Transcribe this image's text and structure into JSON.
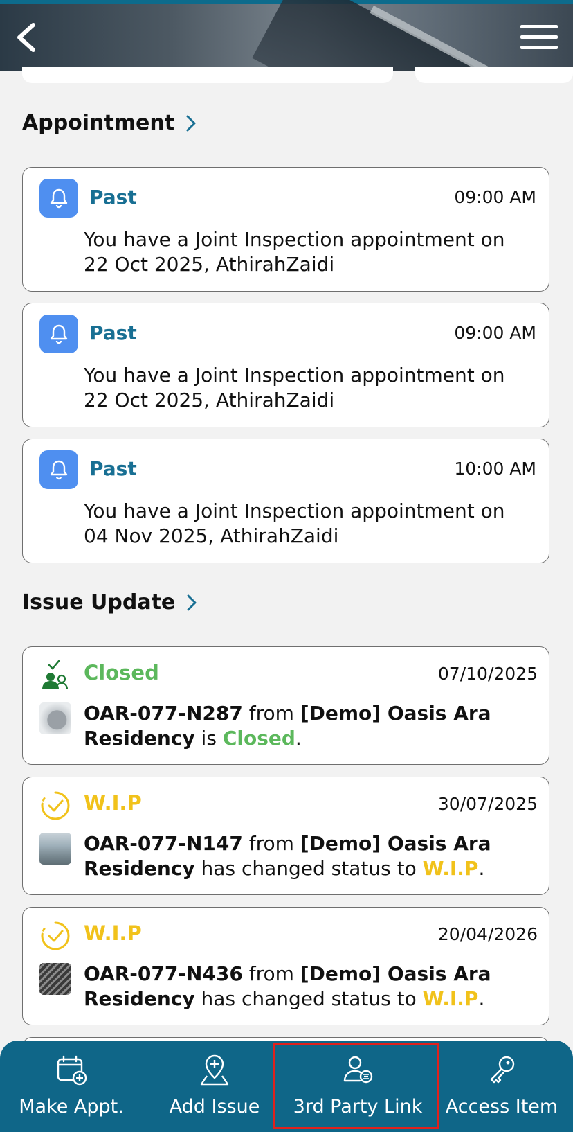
{
  "header": {
    "back_icon": "chevron-left-icon",
    "menu_icon": "hamburger-menu-icon"
  },
  "appointment": {
    "title": "Appointment",
    "items": [
      {
        "status": "Past",
        "time": "09:00 AM",
        "text": "You have a Joint Inspection appointment on 22 Oct 2025, AthirahZaidi"
      },
      {
        "status": "Past",
        "time": "09:00 AM",
        "text": "You have a Joint Inspection appointment on 22 Oct 2025, AthirahZaidi"
      },
      {
        "status": "Past",
        "time": "10:00 AM",
        "text": "You have a Joint Inspection appointment on 04 Nov 2025, AthirahZaidi"
      }
    ]
  },
  "issue_update": {
    "title": "Issue Update",
    "items": [
      {
        "status": "Closed",
        "date": "07/10/2025",
        "code": "OAR-077-N287",
        "from": "from",
        "project": "[Demo] Oasis Ara Residency",
        "mid": "is",
        "status_word": "Closed",
        "end": "."
      },
      {
        "status": "W.I.P",
        "date": "30/07/2025",
        "code": "OAR-077-N147",
        "from": "from",
        "project": "[Demo] Oasis Ara Residency",
        "mid": "has changed status to",
        "status_word": "W.I.P",
        "end": "."
      },
      {
        "status": "W.I.P",
        "date": "20/04/2026",
        "code": "OAR-077-N436",
        "from": "from",
        "project": "[Demo] Oasis Ara Residency",
        "mid": "has changed status to",
        "status_word": "W.I.P",
        "end": "."
      }
    ]
  },
  "bottom_nav": {
    "items": [
      {
        "label": "Make Appt.",
        "icon": "calendar-add-icon"
      },
      {
        "label": "Add Issue",
        "icon": "location-add-icon"
      },
      {
        "label": "3rd Party Link",
        "icon": "user-link-icon"
      },
      {
        "label": "Access Item",
        "icon": "key-icon"
      }
    ]
  },
  "colors": {
    "brand": "#0f6688",
    "past": "#186f93",
    "closed": "#5cb85c",
    "wip": "#f1c21b",
    "highlight": "#e0211d"
  }
}
